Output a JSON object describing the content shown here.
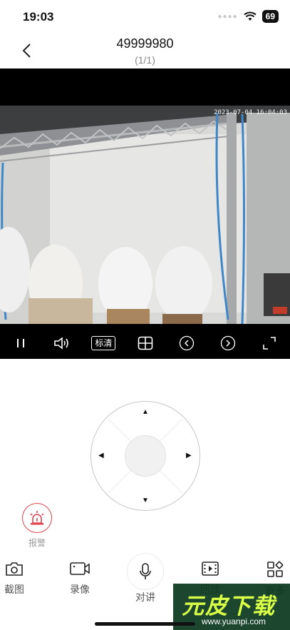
{
  "status_bar": {
    "time": "19:03",
    "battery": "69"
  },
  "header": {
    "title": "49999980",
    "page_counter": "(1/1)"
  },
  "video": {
    "timestamp": "2023-07-04 16:04:03",
    "quality_label": "标清"
  },
  "alarm": {
    "label": "报警"
  },
  "bottom_bar": {
    "items": [
      {
        "label": "截图",
        "icon": "camera-icon"
      },
      {
        "label": "录像",
        "icon": "video-camera-icon"
      },
      {
        "label": "对讲",
        "icon": "microphone-icon"
      },
      {
        "label": "回放",
        "icon": "film-icon"
      },
      {
        "label": "更多",
        "icon": "grid-icon"
      }
    ]
  },
  "watermark": {
    "title": "元皮下载",
    "url": "www.yuanpi.com"
  },
  "colors": {
    "alarm": "#e0454f",
    "video_bg": "#000000"
  }
}
